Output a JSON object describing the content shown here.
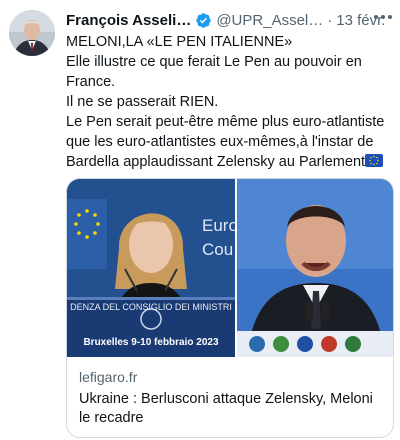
{
  "author": {
    "name": "François Asseli…",
    "handle": "@UPR_Assel…",
    "date": "13 févr.",
    "separator": "·",
    "verified_icon": "verified-badge-icon",
    "avatar_icon": "profile-photo"
  },
  "tweet": {
    "lines": [
      "MELONI,LA «LE PEN ITALIENNE»",
      "Elle illustre ce que ferait Le Pen au pouvoir en",
      "France.",
      "Il ne se passerait RIEN.",
      "Le Pen serait peut-être même plus euro-atlantiste",
      "que les euro-atlantistes eux-mêmes,à l'instar de",
      "Bardella applaudissant Zelensky au Parlement"
    ],
    "trailing_emoji": "eu-flag-icon"
  },
  "card": {
    "domain": "lefigaro.fr",
    "title": "Ukraine : Berlusconi attaque Zelensky, Meloni le recadre",
    "photo_left": {
      "sign_line1": "DENZA DEL CONSIGLIO DEI MINISTRI",
      "sign_line2": "Bruxelles 9-10 febbraio 2023",
      "backdrop_text": "Euro",
      "backdrop_text2": "Cou"
    },
    "photo_right": {
      "subject": "speaker-photo"
    }
  },
  "colors": {
    "verified": "#1d9bf0",
    "secondary_text": "#536471",
    "border": "#cfd9de",
    "eu_blue": "#1d4fb8"
  }
}
